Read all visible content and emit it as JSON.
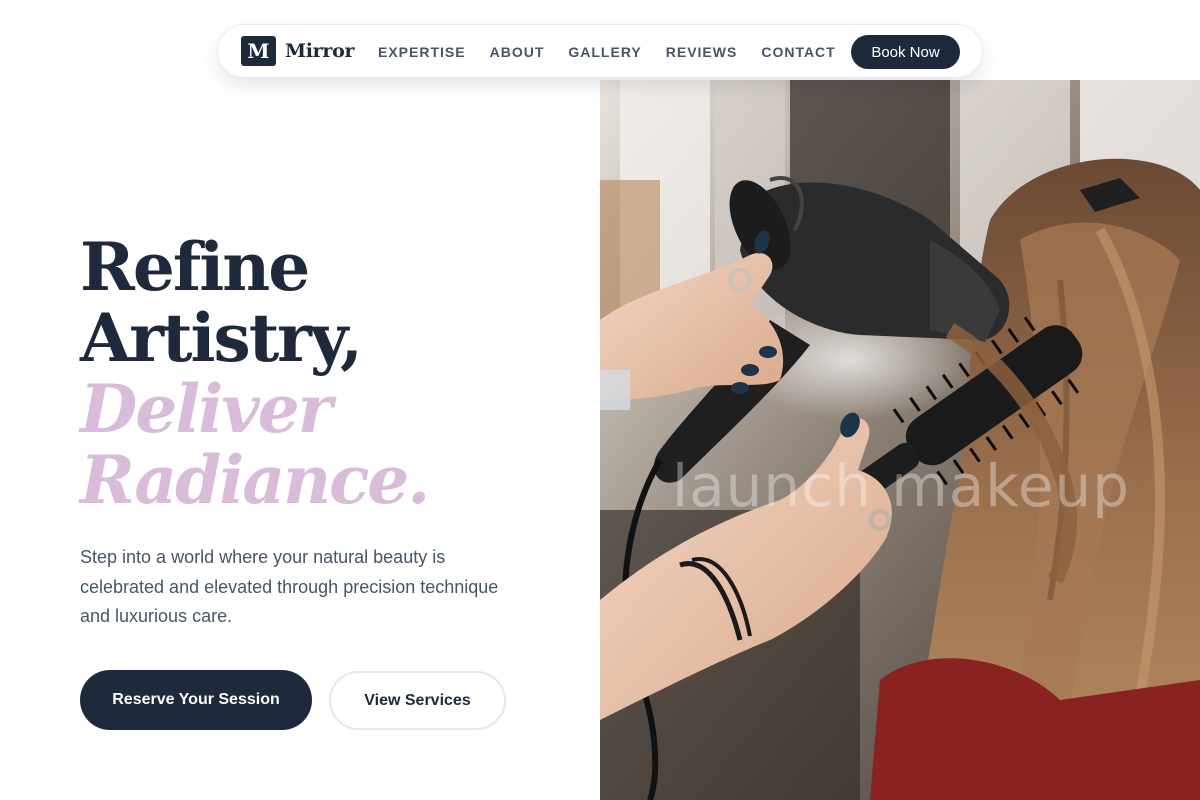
{
  "brand": {
    "logo_letter": "M",
    "name": "Mirror"
  },
  "nav": {
    "items": [
      {
        "label": "EXPERTISE"
      },
      {
        "label": "ABOUT"
      },
      {
        "label": "GALLERY"
      },
      {
        "label": "REVIEWS"
      },
      {
        "label": "CONTACT"
      }
    ],
    "cta_label": "Book Now"
  },
  "hero": {
    "headline_line1": "Refine",
    "headline_line2": "Artistry,",
    "headline_line3": "Deliver",
    "headline_line4": "Radiance.",
    "subtext": "Step into a world where your natural beauty is celebrated and elevated through precision technique and luxurious care.",
    "primary_button": "Reserve Your Session",
    "secondary_button": "View Services"
  },
  "image": {
    "subject": "stylist-blow-drying-hair-photo",
    "watermark": "launch makeup"
  },
  "colors": {
    "navy": "#1e293b",
    "accent_lilac": "#d8bcd9",
    "body_text": "#475569",
    "nav_text": "#475569"
  }
}
